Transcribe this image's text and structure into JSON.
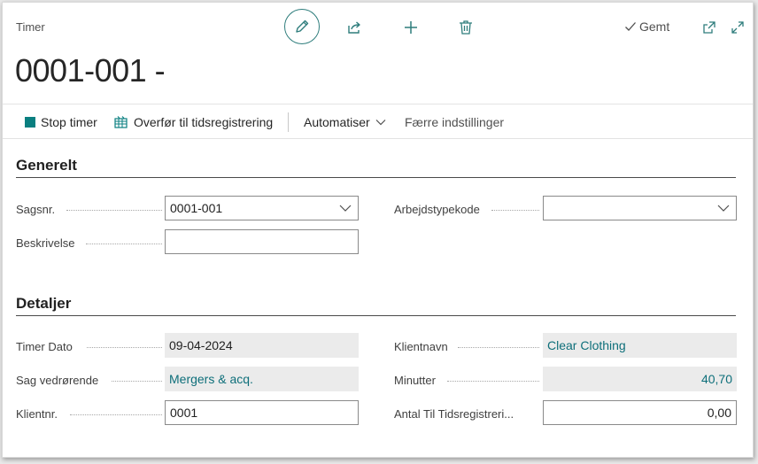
{
  "header": {
    "caption": "Timer",
    "title": "0001-001 -",
    "saved_label": "Gemt"
  },
  "actions": {
    "stop_timer": "Stop timer",
    "transfer": "Overfør til tidsregistrering",
    "automate": "Automatiser",
    "fewer_options": "Færre indstillinger"
  },
  "general": {
    "heading": "Generelt",
    "case_no_label": "Sagsnr.",
    "case_no_value": "0001-001",
    "description_label": "Beskrivelse",
    "description_value": "",
    "worktype_label": "Arbejdstypekode",
    "worktype_value": ""
  },
  "details": {
    "heading": "Detaljer",
    "timer_date_label": "Timer Dato",
    "timer_date_value": "09-04-2024",
    "case_regarding_label": "Sag vedrørende",
    "case_regarding_value": "Mergers & acq.",
    "client_no_label": "Klientnr.",
    "client_no_value": "0001",
    "client_name_label": "Klientnavn",
    "client_name_value": "Clear Clothing",
    "minutes_label": "Minutter",
    "minutes_value": "40,70",
    "to_register_label": "Antal Til Tidsregistreri...",
    "to_register_value": "0,00"
  },
  "colors": {
    "accent": "#0a7f80",
    "link": "#0e6f7a"
  }
}
